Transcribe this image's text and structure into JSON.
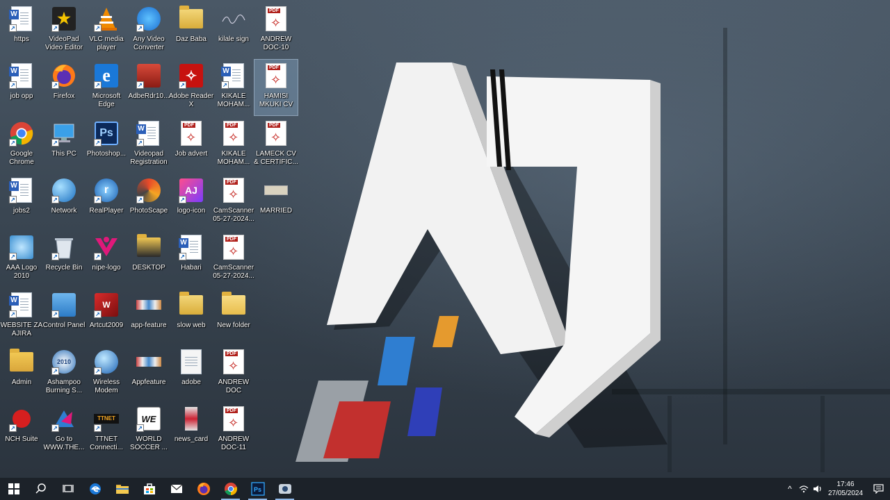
{
  "desktop": {
    "icons": [
      {
        "id": "https",
        "label": "https",
        "kind": "word",
        "col": 0,
        "row": 0
      },
      {
        "id": "videopad",
        "label": "VideoPad Video Editor",
        "kind": "videopad",
        "col": 1,
        "row": 0
      },
      {
        "id": "vlc",
        "label": "VLC media player",
        "kind": "vlc",
        "col": 2,
        "row": 0
      },
      {
        "id": "anyvideo",
        "label": "Any Video Converter",
        "kind": "anyvideo",
        "col": 3,
        "row": 0
      },
      {
        "id": "dazbaba",
        "label": "Daz Baba",
        "kind": "zipfolder",
        "col": 4,
        "row": 0
      },
      {
        "id": "kilale-sign",
        "label": "kilale sign",
        "kind": "signature",
        "col": 5,
        "row": 0
      },
      {
        "id": "andrew-doc-10",
        "label": "ANDREW DOC-10",
        "kind": "pdf",
        "col": 6,
        "row": 0
      },
      {
        "id": "job-opp",
        "label": "job opp",
        "kind": "word",
        "col": 0,
        "row": 1
      },
      {
        "id": "firefox",
        "label": "Firefox",
        "kind": "firefox",
        "col": 1,
        "row": 1
      },
      {
        "id": "edge-legacy",
        "label": "Microsoft Edge",
        "kind": "edge-old",
        "col": 2,
        "row": 1
      },
      {
        "id": "adbrdr",
        "label": "AdbeRdr10...",
        "kind": "adbrdr",
        "col": 3,
        "row": 1
      },
      {
        "id": "adobe-reader-x",
        "label": "Adobe Reader X",
        "kind": "acrobat",
        "col": 4,
        "row": 1
      },
      {
        "id": "kikale-1",
        "label": "KIKALE MOHAM...",
        "kind": "word",
        "col": 5,
        "row": 1
      },
      {
        "id": "hamisi-cv",
        "label": "HAMISI MKUKI CV",
        "kind": "pdf",
        "col": 6,
        "row": 1,
        "selected": true
      },
      {
        "id": "chrome",
        "label": "Google Chrome",
        "kind": "chrome",
        "col": 0,
        "row": 2
      },
      {
        "id": "this-pc",
        "label": "This PC",
        "kind": "thispc",
        "col": 1,
        "row": 2
      },
      {
        "id": "photoshop",
        "label": "Photoshop...",
        "kind": "ps",
        "col": 2,
        "row": 2
      },
      {
        "id": "videopad-reg",
        "label": "Videopad Registration",
        "kind": "word",
        "col": 3,
        "row": 2
      },
      {
        "id": "job-advert",
        "label": "Job advert",
        "kind": "pdf",
        "col": 4,
        "row": 2
      },
      {
        "id": "kikale-2",
        "label": "KIKALE MOHAM...",
        "kind": "pdf",
        "col": 5,
        "row": 2
      },
      {
        "id": "lameck-cv",
        "label": "LAMECK CV & CERTIFIC...",
        "kind": "pdf",
        "col": 6,
        "row": 2
      },
      {
        "id": "jobs2",
        "label": "jobs2",
        "kind": "word",
        "col": 0,
        "row": 3
      },
      {
        "id": "network",
        "label": "Network",
        "kind": "network",
        "col": 1,
        "row": 3
      },
      {
        "id": "realplayer",
        "label": "RealPlayer",
        "kind": "realplayer",
        "col": 2,
        "row": 3
      },
      {
        "id": "photoscape",
        "label": "PhotoScape",
        "kind": "photoscape",
        "col": 3,
        "row": 3
      },
      {
        "id": "logo-icon",
        "label": "logo-icon",
        "kind": "logoicon",
        "col": 4,
        "row": 3
      },
      {
        "id": "camscanner-1",
        "label": "CamScanner 05-27-2024...",
        "kind": "pdf",
        "col": 5,
        "row": 3
      },
      {
        "id": "married",
        "label": "MARRIED",
        "kind": "married",
        "col": 6,
        "row": 3
      },
      {
        "id": "aaa-logo",
        "label": "AAA Logo 2010",
        "kind": "aaalogo",
        "col": 0,
        "row": 4
      },
      {
        "id": "recycle-bin",
        "label": "Recycle Bin",
        "kind": "recycle",
        "col": 1,
        "row": 4
      },
      {
        "id": "nipe-logo",
        "label": "nipe-logo",
        "kind": "nipe",
        "col": 2,
        "row": 4
      },
      {
        "id": "desktop-folder",
        "label": "DESKTOP",
        "kind": "darkfolder",
        "col": 3,
        "row": 4
      },
      {
        "id": "habari",
        "label": "Habari",
        "kind": "word",
        "col": 4,
        "row": 4
      },
      {
        "id": "camscanner-2",
        "label": "CamScanner 05-27-2024...",
        "kind": "pdf",
        "col": 5,
        "row": 4
      },
      {
        "id": "website-za-ajira",
        "label": "WEBSITE ZA AJIRA",
        "kind": "word",
        "col": 0,
        "row": 5
      },
      {
        "id": "control-panel",
        "label": "Control Panel",
        "kind": "controlpanel",
        "col": 1,
        "row": 5
      },
      {
        "id": "artcut",
        "label": "Artcut2009",
        "kind": "artcut",
        "col": 2,
        "row": 5
      },
      {
        "id": "app-feature",
        "label": "app-feature",
        "kind": "strip",
        "col": 3,
        "row": 5
      },
      {
        "id": "slow-web",
        "label": "slow web",
        "kind": "zipfolder",
        "col": 4,
        "row": 5
      },
      {
        "id": "new-folder",
        "label": "New folder",
        "kind": "docfolder",
        "col": 5,
        "row": 5
      },
      {
        "id": "admin",
        "label": "Admin",
        "kind": "userfolder",
        "col": 0,
        "row": 6
      },
      {
        "id": "ashampoo",
        "label": "Ashampoo Burning S...",
        "kind": "ashampoo",
        "col": 1,
        "row": 6
      },
      {
        "id": "wireless",
        "label": "Wireless Modem",
        "kind": "globe",
        "col": 2,
        "row": 6
      },
      {
        "id": "appfeature",
        "label": "Appfeature",
        "kind": "strip",
        "col": 3,
        "row": 6
      },
      {
        "id": "adobe",
        "label": "adobe",
        "kind": "blank",
        "col": 4,
        "row": 6
      },
      {
        "id": "andrew-doc",
        "label": "ANDREW DOC",
        "kind": "pdf",
        "col": 5,
        "row": 6
      },
      {
        "id": "nch-suite",
        "label": "NCH Suite",
        "kind": "nch",
        "col": 0,
        "row": 7
      },
      {
        "id": "goto-www",
        "label": "Go to WWW.THE...",
        "kind": "goto",
        "col": 1,
        "row": 7
      },
      {
        "id": "ttnet",
        "label": "TTNET Connecti...",
        "kind": "ttnet",
        "col": 2,
        "row": 7
      },
      {
        "id": "world-soccer",
        "label": "WORLD SOCCER ...",
        "kind": "we",
        "col": 3,
        "row": 7
      },
      {
        "id": "news-card",
        "label": "news_card",
        "kind": "newscard",
        "col": 4,
        "row": 7
      },
      {
        "id": "andrew-doc-11",
        "label": "ANDREW DOC-11",
        "kind": "pdf",
        "col": 5,
        "row": 7
      }
    ]
  },
  "taskbar": {
    "buttons": [
      {
        "id": "start",
        "icon": "windows-icon"
      },
      {
        "id": "search",
        "icon": "search-icon"
      },
      {
        "id": "task-view",
        "icon": "task-view-icon"
      },
      {
        "id": "edge",
        "icon": "edge-icon"
      },
      {
        "id": "file-explorer",
        "icon": "folder-icon"
      },
      {
        "id": "store",
        "icon": "store-icon"
      },
      {
        "id": "mail",
        "icon": "mail-icon"
      },
      {
        "id": "firefox",
        "icon": "firefox-icon"
      },
      {
        "id": "chrome",
        "icon": "chrome-icon",
        "active": true
      },
      {
        "id": "photoshop",
        "icon": "photoshop-icon",
        "active": true
      },
      {
        "id": "screen-recorder",
        "icon": "camera-icon",
        "active": true
      }
    ],
    "tray": {
      "overflow_glyph": "^",
      "time": "17:46",
      "date": "27/05/2024"
    }
  },
  "colors": {
    "taskbar": "#1c2229",
    "wallpaper": "#3a4652",
    "pdf_red": "#b0201b"
  },
  "wallpaper_logo_text": "AJ"
}
